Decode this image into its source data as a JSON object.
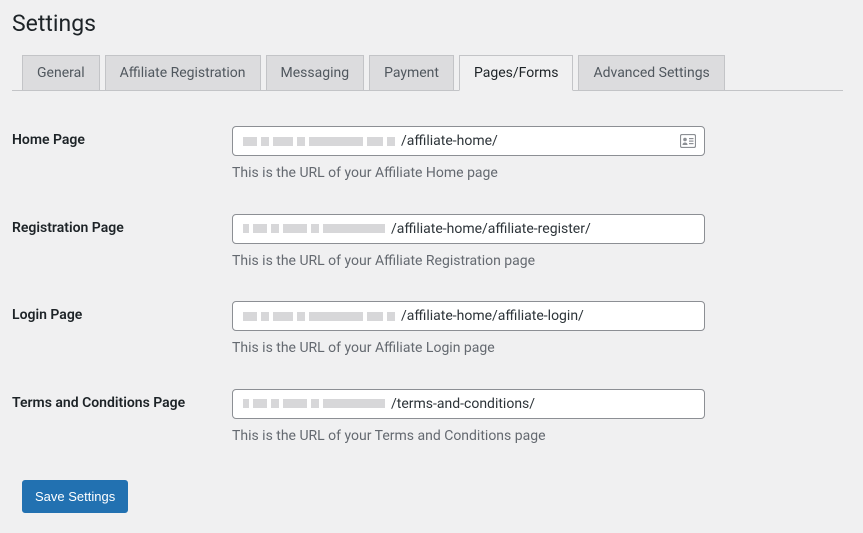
{
  "page_title": "Settings",
  "tabs": [
    {
      "label": "General",
      "active": false
    },
    {
      "label": "Affiliate Registration",
      "active": false
    },
    {
      "label": "Messaging",
      "active": false
    },
    {
      "label": "Payment",
      "active": false
    },
    {
      "label": "Pages/Forms",
      "active": true
    },
    {
      "label": "Advanced Settings",
      "active": false
    }
  ],
  "fields": {
    "home_page": {
      "label": "Home Page",
      "value": "/affiliate-home/",
      "description": "This is the URL of your Affiliate Home page"
    },
    "registration_page": {
      "label": "Registration Page",
      "value": "/affiliate-home/affiliate-register/",
      "description": "This is the URL of your Affiliate Registration page"
    },
    "login_page": {
      "label": "Login Page",
      "value": "/affiliate-home/affiliate-login/",
      "description": "This is the URL of your Affiliate Login page"
    },
    "terms_page": {
      "label": "Terms and Conditions Page",
      "value": "/terms-and-conditions/",
      "description": "This is the URL of your Terms and Conditions page"
    }
  },
  "save_button": "Save Settings"
}
